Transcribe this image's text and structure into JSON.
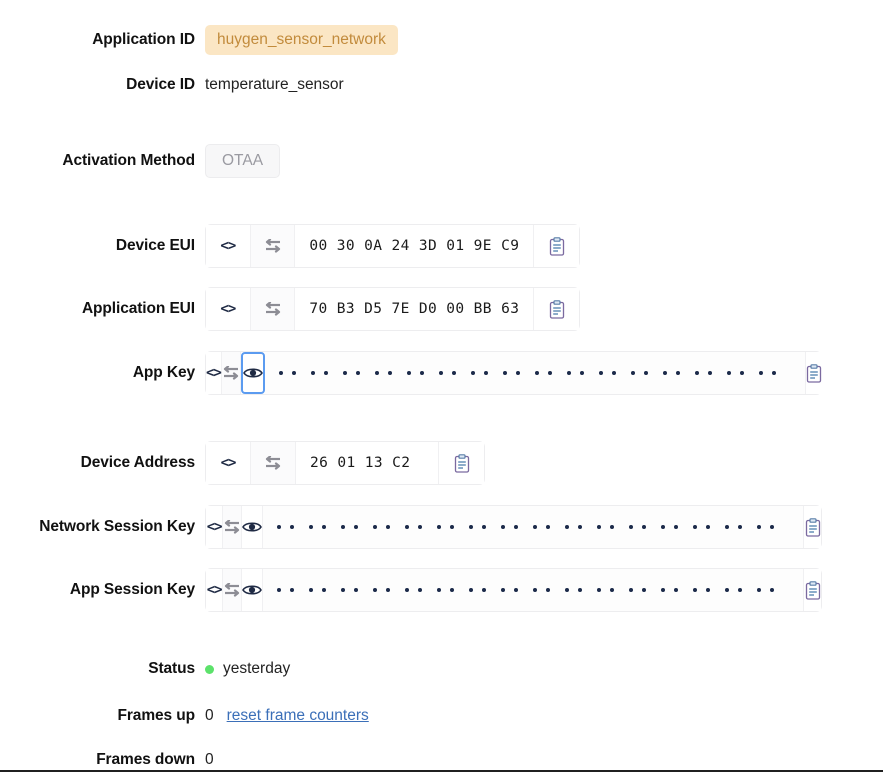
{
  "fields": {
    "application_id": {
      "label": "Application ID",
      "value": "huygen_sensor_network"
    },
    "device_id": {
      "label": "Device ID",
      "value": "temperature_sensor"
    },
    "activation_method": {
      "label": "Activation Method",
      "value": "OTAA"
    },
    "device_eui": {
      "label": "Device EUI",
      "value": "00 30 0A 24 3D 01 9E C9"
    },
    "application_eui": {
      "label": "Application EUI",
      "value": "70 B3 D5 7E D0 00 BB 63"
    },
    "app_key": {
      "label": "App Key",
      "value": "",
      "masked": true,
      "mask_pairs": 16
    },
    "device_address": {
      "label": "Device Address",
      "value": "26 01 13 C2"
    },
    "network_session_key": {
      "label": "Network Session Key",
      "value": "",
      "masked": true,
      "mask_pairs": 16
    },
    "app_session_key": {
      "label": "App Session Key",
      "value": "",
      "masked": true,
      "mask_pairs": 16
    }
  },
  "status": {
    "label": "Status",
    "value": "yesterday",
    "dot_color": "#5ce26b"
  },
  "frames_up": {
    "label": "Frames up",
    "value": "0",
    "reset_link": "reset frame counters"
  },
  "frames_down": {
    "label": "Frames down",
    "value": "0"
  },
  "icons": {
    "code": "<>",
    "swap": "swap-icon",
    "eye": "eye-icon",
    "copy": "clipboard-icon"
  },
  "colors": {
    "app_badge_bg": "#fbe6c4",
    "app_badge_text": "#c28b3c",
    "otaa_bg": "#f7f7f8",
    "otaa_text": "#9a9aa1",
    "focus_ring": "#5b9bf0",
    "link": "#3b6fb8",
    "status_green": "#5ce26b"
  }
}
